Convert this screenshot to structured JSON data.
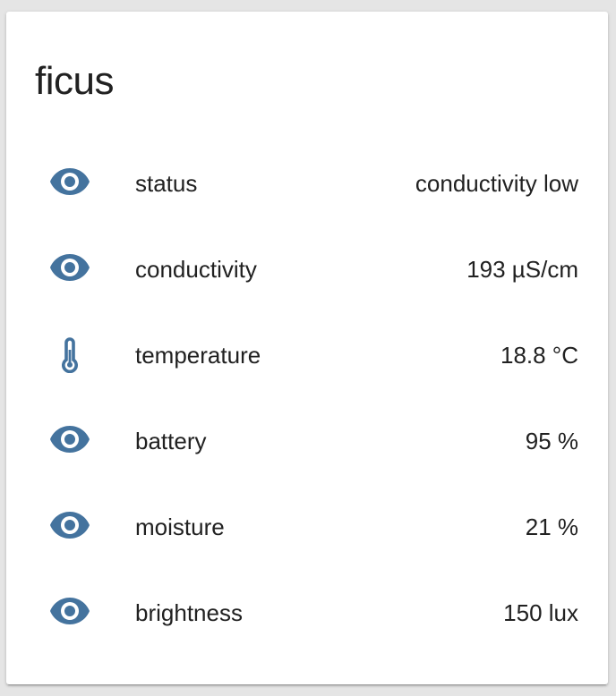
{
  "card": {
    "title": "ficus",
    "accent_color": "#44739e",
    "rows": [
      {
        "icon": "eye-icon",
        "label": "status",
        "value": "conductivity low"
      },
      {
        "icon": "eye-icon",
        "label": "conductivity",
        "value": "193 µS/cm"
      },
      {
        "icon": "thermometer-icon",
        "label": "temperature",
        "value": "18.8 °C"
      },
      {
        "icon": "eye-icon",
        "label": "battery",
        "value": "95 %"
      },
      {
        "icon": "eye-icon",
        "label": "moisture",
        "value": "21 %"
      },
      {
        "icon": "eye-icon",
        "label": "brightness",
        "value": "150 lux"
      }
    ]
  }
}
